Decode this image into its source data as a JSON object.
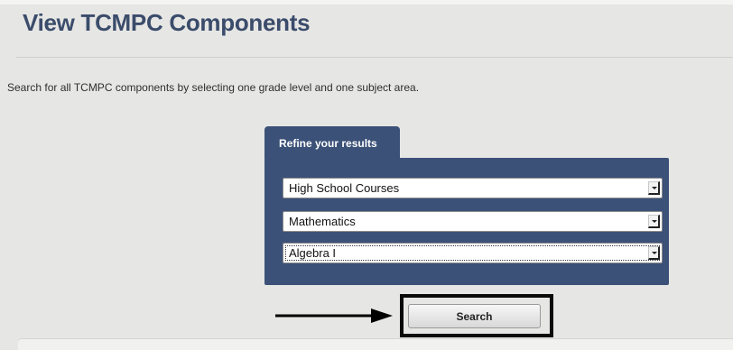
{
  "header": {
    "title": "View TCMPC Components"
  },
  "intro_text": "Search for all TCMPC components by selecting one grade level and one subject area.",
  "refine_panel": {
    "tab_label": "Refine your results",
    "grade_select": {
      "selected": "High School Courses"
    },
    "subject_select": {
      "selected": "Mathematics"
    },
    "course_select": {
      "selected": "Algebra I"
    }
  },
  "search_button": {
    "label": "Search"
  },
  "annotation": {
    "arrow_color": "#000000",
    "highlight_color": "#000000"
  },
  "colors": {
    "panel": "#3b5178",
    "title": "#3b4c6b",
    "background": "#e6e6e4"
  }
}
